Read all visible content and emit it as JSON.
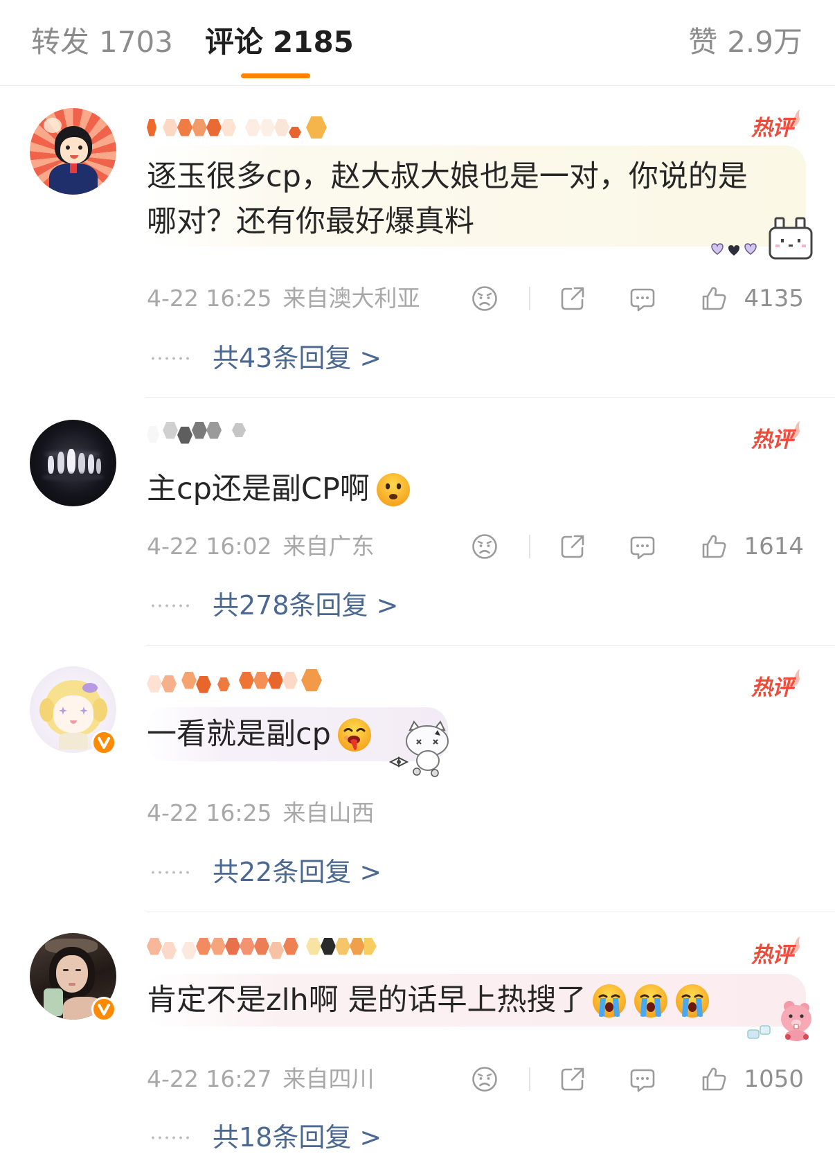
{
  "tabs": {
    "reposts": {
      "label": "转发",
      "count": "1703"
    },
    "comments": {
      "label": "评论",
      "count": "2185",
      "active": true
    },
    "likes": {
      "label": "赞",
      "count": "2.9万"
    }
  },
  "hot_badge": "热评",
  "action_icons": [
    "sad-face-icon",
    "share-icon",
    "comment-icon",
    "thumbs-up-icon"
  ],
  "colors": {
    "accent": "#ff8200",
    "hot_badge": "#f04a3a",
    "reply_link": "#4a6891",
    "meta_text": "#a8a8a8",
    "verified_badge": "#ff8a00"
  },
  "comments": [
    {
      "hot": true,
      "verified": false,
      "text_lines": [
        "逐玉很多cp，赵大叔大娘也是一对，你说的是",
        "哪对？还有你最好爆真料"
      ],
      "emoji": [],
      "time": "4-22 16:25",
      "location": "来自澳大利亚",
      "likes": "4135",
      "replies": "共43条回复 >"
    },
    {
      "hot": true,
      "verified": false,
      "text": "主cp还是副CP啊",
      "emoji": [
        "worried-face"
      ],
      "time": "4-22 16:02",
      "location": "来自广东",
      "likes": "1614",
      "replies": "共278条回复 >"
    },
    {
      "hot": true,
      "verified": true,
      "text": "一看就是副cp",
      "emoji": [
        "drooling-face"
      ],
      "time": "4-22 16:25",
      "location": "来自山西",
      "replies": "共22条回复 >"
    },
    {
      "hot": true,
      "verified": true,
      "text": "肯定不是zlh啊 是的话早上热搜了",
      "emoji": [
        "loudly-crying-face",
        "loudly-crying-face",
        "loudly-crying-face"
      ],
      "time": "4-22 16:27",
      "location": "来自四川",
      "likes": "1050",
      "replies": "共18条回复 >"
    }
  ]
}
